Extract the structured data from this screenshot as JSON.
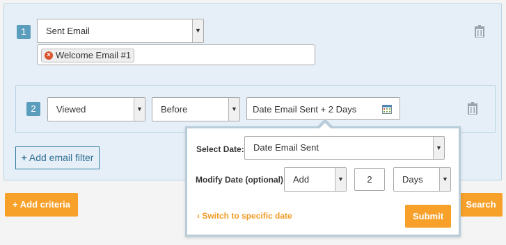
{
  "criteria": [
    {
      "number": "1",
      "event": "Sent Email",
      "tags": [
        "Welcome Email #1"
      ]
    }
  ],
  "filter": {
    "number": "2",
    "action": "Viewed",
    "timing": "Before",
    "date_value": "Date Email Sent + 2 Days"
  },
  "buttons": {
    "add_email_filter": "Add email filter",
    "add_criteria": "Add criteria",
    "search": "Search"
  },
  "popover": {
    "select_date_label": "Select Date:",
    "select_date_value": "Date Email Sent",
    "modify_date_label": "Modify Date (optional):",
    "modify_op": "Add",
    "modify_amount": "2",
    "modify_unit": "Days",
    "switch_link": "Switch to specific date",
    "submit": "Submit"
  },
  "colors": {
    "badge": "#5b9dbd",
    "accent_orange": "#f7a02a",
    "panel_bg": "#e6eff7",
    "remove_tag": "#d9532c"
  },
  "icons": {
    "trash": "trash-icon",
    "calendar": "calendar-icon",
    "remove_tag": "remove-tag-icon",
    "plus": "plus-icon",
    "chevron_left": "chevron-left-icon"
  }
}
